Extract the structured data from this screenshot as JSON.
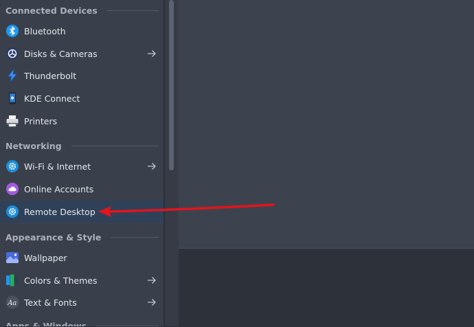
{
  "sidebar": {
    "sections": [
      {
        "title": "Connected Devices"
      },
      {
        "title": "Networking"
      },
      {
        "title": "Appearance & Style"
      },
      {
        "title": "Apps & Windows"
      }
    ],
    "items": [
      {
        "label": "Bluetooth",
        "icon": "bluetooth-icon",
        "has_submenu": false
      },
      {
        "label": "Disks & Cameras",
        "icon": "disks-cameras-icon",
        "has_submenu": true
      },
      {
        "label": "Thunderbolt",
        "icon": "thunderbolt-icon",
        "has_submenu": false
      },
      {
        "label": "KDE Connect",
        "icon": "kde-connect-icon",
        "has_submenu": false
      },
      {
        "label": "Printers",
        "icon": "printer-icon",
        "has_submenu": false
      },
      {
        "label": "Wi-Fi & Internet",
        "icon": "wifi-settings-icon",
        "has_submenu": true
      },
      {
        "label": "Online Accounts",
        "icon": "cloud-icon",
        "has_submenu": false
      },
      {
        "label": "Remote Desktop",
        "icon": "remote-desktop-icon",
        "has_submenu": false,
        "selected": true
      },
      {
        "label": "Wallpaper",
        "icon": "wallpaper-icon",
        "has_submenu": false
      },
      {
        "label": "Colors & Themes",
        "icon": "colors-themes-icon",
        "has_submenu": true
      },
      {
        "label": "Text & Fonts",
        "icon": "fonts-icon",
        "has_submenu": true
      }
    ]
  },
  "colors": {
    "sidebar_bg": "#3a404b",
    "selected_bg": "#2f4158",
    "content_bg": "#3d434e",
    "annotation_arrow": "#e3141c"
  }
}
